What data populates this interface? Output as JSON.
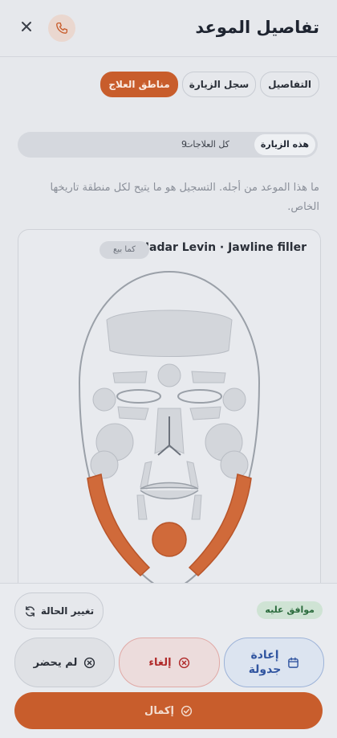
{
  "header": {
    "title": "تفاصيل الموعد",
    "close_icon": "close-icon",
    "phone_icon": "phone-icon"
  },
  "tabs": [
    {
      "label": "التفاصيل",
      "active": false
    },
    {
      "label": "سجل الزيارة",
      "active": false
    },
    {
      "label": "مناطق العلاج",
      "active": true
    }
  ],
  "segment": {
    "this_visit": "هذه الزيارة",
    "all_treatments": "كل العلاجات",
    "all_count": "9"
  },
  "description": "ما هذا الموعد من أجله. التسجيل هو ما يتيح لكل منطقة تاريخها الخاص.",
  "card": {
    "title": "Hadar Levin · Jawline filler",
    "badge": "كما بيع"
  },
  "status": {
    "badge": "موافق عليه",
    "change_label": "تغيير الحالة"
  },
  "actions": {
    "reschedule_line1": "إعادة",
    "reschedule_line2": "جدولة",
    "cancel": "إلغاء",
    "no_show": "لم يحضر",
    "complete": "إكمال"
  },
  "colors": {
    "accent": "#c85d2c",
    "approved": "#2b6b3d",
    "reschedule": "#3155a0",
    "cancel": "#b02a2a"
  }
}
